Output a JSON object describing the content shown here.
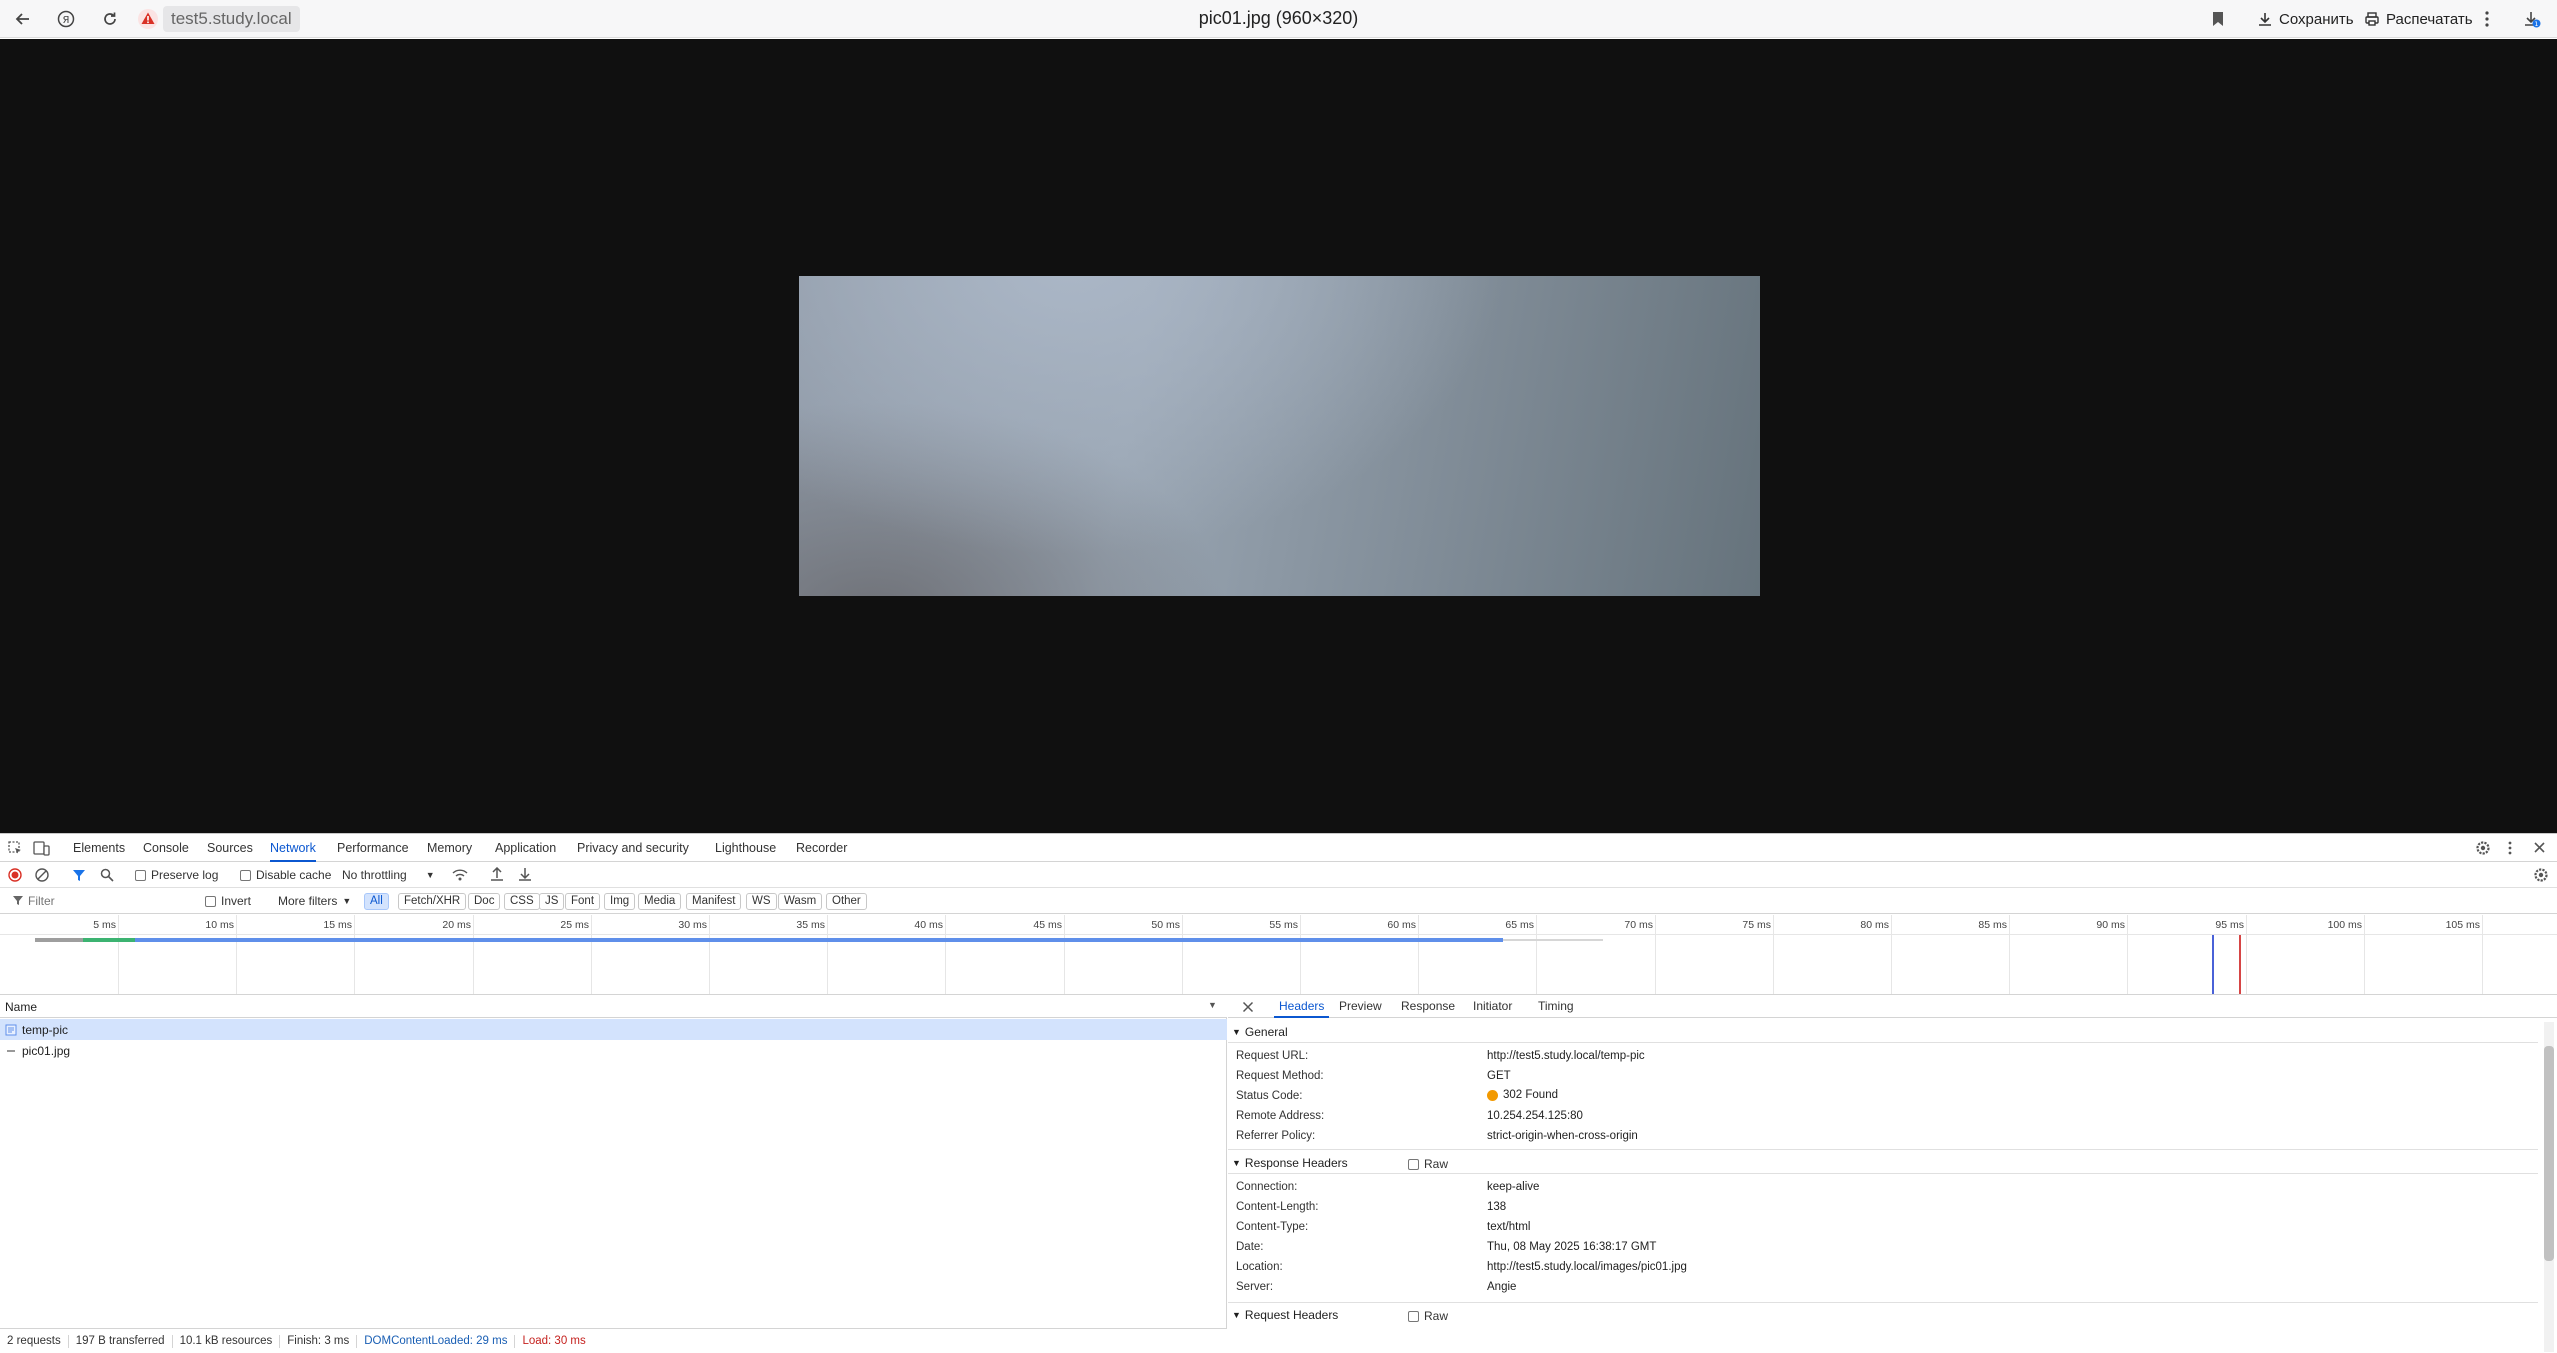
{
  "browser": {
    "address_host": "test5.study.local",
    "page_title": "pic01.jpg (960×320)",
    "save_label": "Сохранить",
    "print_label": "Распечатать",
    "downloads_badge": "1"
  },
  "devtools": {
    "tabs": [
      "Elements",
      "Console",
      "Sources",
      "Network",
      "Performance",
      "Memory",
      "Application",
      "Privacy and security",
      "Lighthouse",
      "Recorder"
    ],
    "active_tab": "Network",
    "toolbar": {
      "preserve_log": "Preserve log",
      "disable_cache": "Disable cache",
      "throttling": "No throttling"
    },
    "filter": {
      "placeholder": "Filter",
      "invert": "Invert",
      "more_filters": "More filters",
      "types": [
        "All",
        "Fetch/XHR",
        "Doc",
        "CSS",
        "JS",
        "Font",
        "Img",
        "Media",
        "Manifest",
        "WS",
        "Wasm",
        "Other"
      ],
      "active_type": "All"
    },
    "timeline": {
      "ticks": [
        "5 ms",
        "10 ms",
        "15 ms",
        "20 ms",
        "25 ms",
        "30 ms",
        "35 ms",
        "40 ms",
        "45 ms",
        "50 ms",
        "55 ms",
        "60 ms",
        "65 ms",
        "70 ms",
        "75 ms",
        "80 ms",
        "85 ms",
        "90 ms",
        "95 ms",
        "100 ms",
        "105 ms"
      ],
      "dom_content_loaded_ms": 29,
      "load_ms": 30,
      "colors": {
        "dcl": "#4a62d8",
        "load": "#d64545",
        "bar": "#5f8fea",
        "waiting": "#3cb371"
      }
    },
    "requests": {
      "column_name": "Name",
      "rows": [
        {
          "name": "temp-pic",
          "icon": "document-icon",
          "selected": true
        },
        {
          "name": "pic01.jpg",
          "icon": "dash-icon",
          "selected": false
        }
      ]
    },
    "details": {
      "tabs": [
        "Headers",
        "Preview",
        "Response",
        "Initiator",
        "Timing"
      ],
      "active_tab": "Headers",
      "general_title": "General",
      "general": [
        {
          "name": "Request URL:",
          "value": "http://test5.study.local/temp-pic"
        },
        {
          "name": "Request Method:",
          "value": "GET"
        },
        {
          "name": "Status Code:",
          "value": "302 Found"
        },
        {
          "name": "Remote Address:",
          "value": "10.254.254.125:80"
        },
        {
          "name": "Referrer Policy:",
          "value": "strict-origin-when-cross-origin"
        }
      ],
      "response_headers_title": "Response Headers",
      "raw_label": "Raw",
      "response_headers": [
        {
          "name": "Connection:",
          "value": "keep-alive"
        },
        {
          "name": "Content-Length:",
          "value": "138"
        },
        {
          "name": "Content-Type:",
          "value": "text/html"
        },
        {
          "name": "Date:",
          "value": "Thu, 08 May 2025 16:38:17 GMT"
        },
        {
          "name": "Location:",
          "value": "http://test5.study.local/images/pic01.jpg"
        },
        {
          "name": "Server:",
          "value": "Angie"
        }
      ],
      "request_headers_title": "Request Headers"
    },
    "status": {
      "requests": "2 requests",
      "transferred": "197 B transferred",
      "resources": "10.1 kB resources",
      "finish": "Finish: 3 ms",
      "dom_content_loaded": "DOMContentLoaded: 29 ms",
      "load": "Load: 30 ms"
    }
  }
}
